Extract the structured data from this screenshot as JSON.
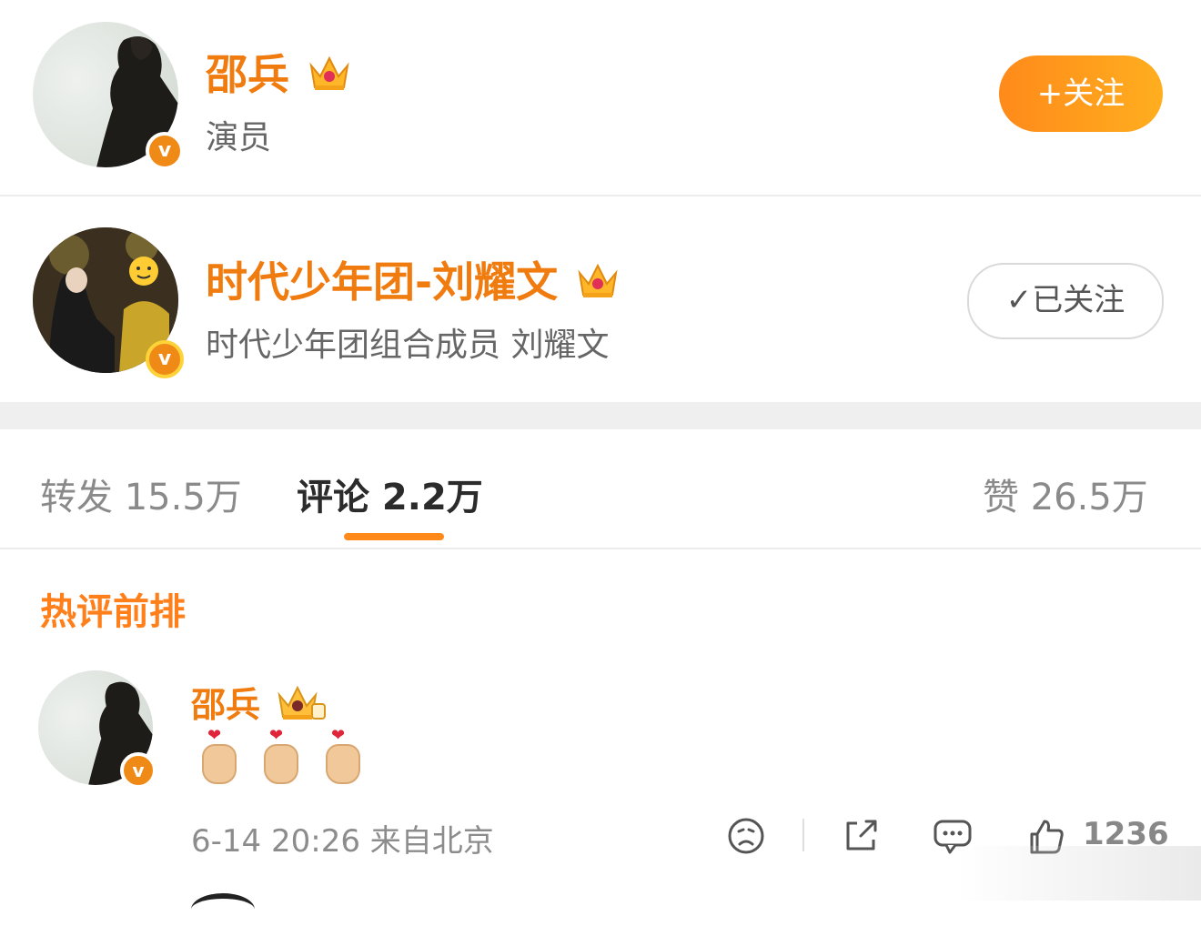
{
  "users": [
    {
      "name": "邵兵",
      "description": "演员",
      "verified_icon": "v",
      "crown_icon": "crown-icon",
      "follow_label": "+关注",
      "followed": false
    },
    {
      "name": "时代少年团-刘耀文",
      "description": "时代少年团组合成员 刘耀文",
      "verified_icon": "v",
      "crown_icon": "crown-icon",
      "follow_label": "✓已关注",
      "followed": true
    }
  ],
  "tabs": {
    "repost": "转发 15.5万",
    "comment": "评论 2.2万",
    "like": "赞 26.5万",
    "active": "comment"
  },
  "hot_comments_title": "热评前排",
  "comment": {
    "author": "邵兵",
    "verified_icon": "v",
    "content_icons": [
      "finger-heart-icon",
      "finger-heart-icon",
      "finger-heart-icon"
    ],
    "meta": "6-14 20:26 来自北京",
    "like_count": "1236"
  },
  "colors": {
    "accent": "#f07b0f",
    "follow_btn": "#ff8a1a",
    "tab_underline": "#ff8a1a"
  }
}
